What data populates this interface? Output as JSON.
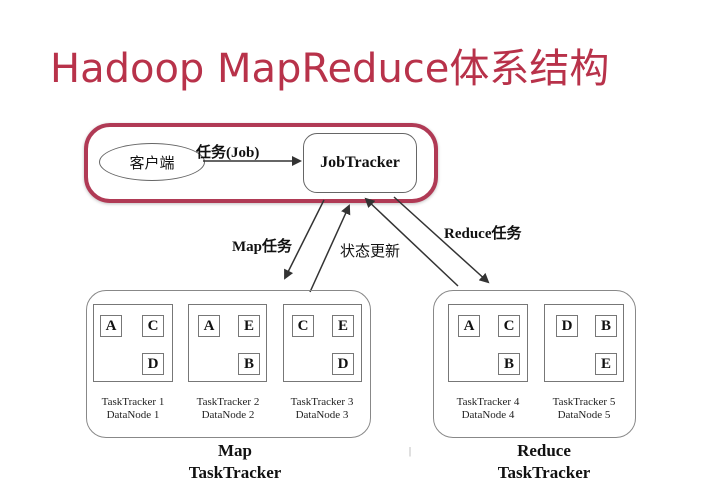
{
  "title": "Hadoop MapReduce体系结构",
  "client": {
    "label": "客户端"
  },
  "jobtracker": {
    "label": "JobTracker"
  },
  "edges": {
    "job": "任务(Job)",
    "map_task": "Map任务",
    "status_update": "状态更新",
    "reduce_task": "Reduce任务"
  },
  "map_group": {
    "caption_line1": "Map",
    "caption_line2": "TaskTracker",
    "nodes": [
      {
        "tasktracker": "TaskTracker 1",
        "datanode": "DataNode 1",
        "blocks": [
          "A",
          "C",
          "D"
        ]
      },
      {
        "tasktracker": "TaskTracker 2",
        "datanode": "DataNode 2",
        "blocks": [
          "A",
          "E",
          "B"
        ]
      },
      {
        "tasktracker": "TaskTracker 3",
        "datanode": "DataNode 3",
        "blocks": [
          "C",
          "E",
          "D"
        ]
      }
    ]
  },
  "reduce_group": {
    "caption_line1": "Reduce",
    "caption_line2": "TaskTracker",
    "nodes": [
      {
        "tasktracker": "TaskTracker 4",
        "datanode": "DataNode 4",
        "blocks": [
          "A",
          "C",
          "B"
        ]
      },
      {
        "tasktracker": "TaskTracker 5",
        "datanode": "DataNode 5",
        "blocks": [
          "D",
          "B",
          "E"
        ]
      }
    ]
  },
  "misc_mark": "|"
}
